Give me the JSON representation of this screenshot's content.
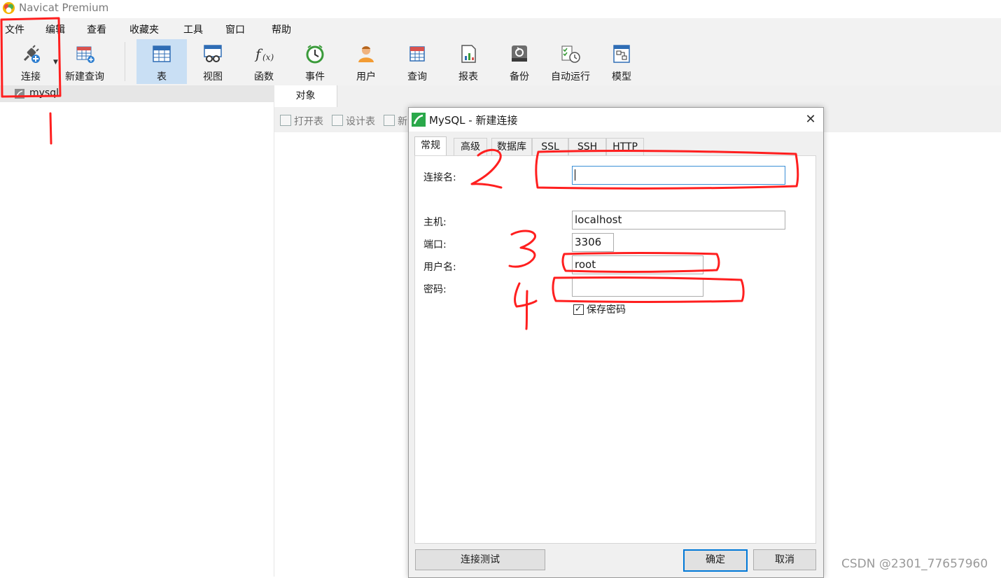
{
  "window": {
    "title": "Navicat Premium"
  },
  "menubar": {
    "items": [
      "文件",
      "编辑",
      "查看",
      "收藏夹",
      "工具",
      "窗口",
      "帮助"
    ]
  },
  "toolbar": {
    "connect": "连接",
    "new_query": "新建查询",
    "items": [
      {
        "label": "表",
        "icon": "table-icon",
        "active": true
      },
      {
        "label": "视图",
        "icon": "view-icon",
        "active": false
      },
      {
        "label": "函数",
        "icon": "function-icon",
        "active": false
      },
      {
        "label": "事件",
        "icon": "event-clock-icon",
        "active": false
      },
      {
        "label": "用户",
        "icon": "user-icon",
        "active": false
      },
      {
        "label": "查询",
        "icon": "query-icon",
        "active": false
      },
      {
        "label": "报表",
        "icon": "report-icon",
        "active": false
      },
      {
        "label": "备份",
        "icon": "backup-icon",
        "active": false
      },
      {
        "label": "自动运行",
        "icon": "schedule-icon",
        "active": false
      },
      {
        "label": "模型",
        "icon": "model-icon",
        "active": false
      }
    ]
  },
  "sidebar": {
    "connection": "mysql"
  },
  "main": {
    "tab": "对象",
    "object_toolbar": [
      "打开表",
      "设计表",
      "新"
    ]
  },
  "dialog": {
    "title": "MySQL - 新建连接",
    "close": "✕",
    "tabs": [
      "常规",
      "高级",
      "数据库",
      "SSL",
      "SSH",
      "HTTP"
    ],
    "active_tab": "常规",
    "fields": {
      "connection_name": {
        "label": "连接名:",
        "value": ""
      },
      "host": {
        "label": "主机:",
        "value": "localhost"
      },
      "port": {
        "label": "端口:",
        "value": "3306"
      },
      "username": {
        "label": "用户名:",
        "value": "root"
      },
      "password": {
        "label": "密码:",
        "value": ""
      }
    },
    "save_password": {
      "label": "保存密码",
      "checked": true
    },
    "buttons": {
      "test": "连接测试",
      "ok": "确定",
      "cancel": "取消"
    }
  },
  "watermark": "CSDN @2301_77657960",
  "colors": {
    "annotation": "#ff1f1f",
    "accent": "#0078d7",
    "active_tool": "#c9dff4"
  }
}
